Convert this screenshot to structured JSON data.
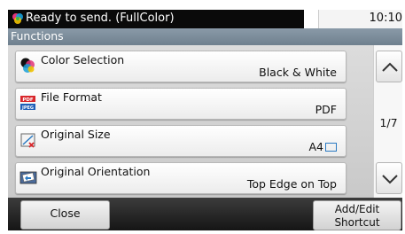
{
  "status": {
    "message": "Ready to send. (FullColor)",
    "time": "10:10"
  },
  "header": {
    "title": "Functions"
  },
  "functions": [
    {
      "label": "Color Selection",
      "value": "Black & White",
      "icon": "color-selection-icon"
    },
    {
      "label": "File Format",
      "value": "PDF",
      "icon": "file-format-icon"
    },
    {
      "label": "Original Size",
      "value": "A4",
      "icon": "original-size-icon"
    },
    {
      "label": "Original Orientation",
      "value": "Top Edge on Top",
      "icon": "original-orientation-icon"
    }
  ],
  "icon_text": {
    "pdf": "PDF",
    "jpeg": "JPEG"
  },
  "pager": {
    "page": "1/7"
  },
  "footer": {
    "close_label": "Close",
    "shortcut_line1": "Add/Edit",
    "shortcut_line2": "Shortcut"
  },
  "colors": {
    "status_bar": "#0a0a0a",
    "header": "#7d8e9c",
    "list_bg": "#d2d2d2",
    "bottom_bar": "#222222",
    "paper_icon": "#2a7ac2"
  }
}
